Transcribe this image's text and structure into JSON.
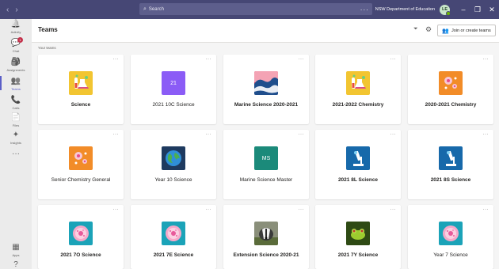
{
  "titlebar": {
    "back_glyph": "‹",
    "forward_glyph": "›",
    "search_placeholder": "Search",
    "more_glyph": "···",
    "org_name": "NSW Department of Education",
    "avatar_initials": "LE",
    "min_glyph": "–",
    "restore_glyph": "❐",
    "close_glyph": "✕"
  },
  "rail": [
    {
      "name": "activity",
      "label": "Activity",
      "icon": "bell-icon"
    },
    {
      "name": "chat",
      "label": "Chat",
      "icon": "chat-icon",
      "badge": "1"
    },
    {
      "name": "assignments",
      "label": "Assignments",
      "icon": "assignments-icon"
    },
    {
      "name": "teams",
      "label": "Teams",
      "icon": "teams-icon",
      "active": true
    },
    {
      "name": "calls",
      "label": "Calls",
      "icon": "phone-icon"
    },
    {
      "name": "files",
      "label": "Files",
      "icon": "file-icon"
    },
    {
      "name": "insights",
      "label": "Insights",
      "icon": "insights-icon"
    },
    {
      "name": "more",
      "label": "",
      "icon": "more-icon"
    },
    {
      "name": "apps",
      "label": "Apps",
      "icon": "apps-icon"
    },
    {
      "name": "help",
      "label": "",
      "icon": "help-icon"
    }
  ],
  "header": {
    "title": "Teams",
    "join_label": "Join or create teams"
  },
  "section_label": "Your teams",
  "teams": [
    {
      "name": "Science",
      "bold": true,
      "thumb": "science-beakers",
      "bg": "#f2c531"
    },
    {
      "name": "2021 10C Science",
      "bold": false,
      "thumb": "initials",
      "initials": "21",
      "bg": "#8b5cf6"
    },
    {
      "name": "Marine Science 2020-2021",
      "bold": true,
      "thumb": "wave",
      "bg": "#d9455f"
    },
    {
      "name": "2021-2022 Chemistry",
      "bold": true,
      "thumb": "science-beakers",
      "bg": "#f2c531"
    },
    {
      "name": "2020-2021 Chemistry",
      "bold": true,
      "thumb": "molecules",
      "bg": "#f28c28"
    },
    {
      "name": "Senior Chemistry General",
      "bold": false,
      "thumb": "molecules",
      "bg": "#f28c28"
    },
    {
      "name": "Year 10 Science",
      "bold": false,
      "thumb": "globe",
      "bg": "#1e3a5f"
    },
    {
      "name": "Marine Science Master",
      "bold": false,
      "thumb": "initials",
      "initials": "MS",
      "bg": "#1b8a7a"
    },
    {
      "name": "2021 8L Science",
      "bold": true,
      "thumb": "microscope",
      "bg": "#1769aa"
    },
    {
      "name": "2021 8S Science",
      "bold": true,
      "thumb": "microscope",
      "bg": "#1769aa"
    },
    {
      "name": "2021 7O Science",
      "bold": true,
      "thumb": "cell",
      "bg": "#1ba3b8"
    },
    {
      "name": "2021 7E Science",
      "bold": true,
      "thumb": "cell",
      "bg": "#1ba3b8"
    },
    {
      "name": "Extension Science 2020-21",
      "bold": true,
      "thumb": "badger",
      "bg": "#8a8f7a"
    },
    {
      "name": "2021 7Y Science",
      "bold": true,
      "thumb": "frog",
      "bg": "#3d5c1a"
    },
    {
      "name": "Year 7 Science",
      "bold": false,
      "thumb": "cell",
      "bg": "#1ba3b8"
    }
  ]
}
